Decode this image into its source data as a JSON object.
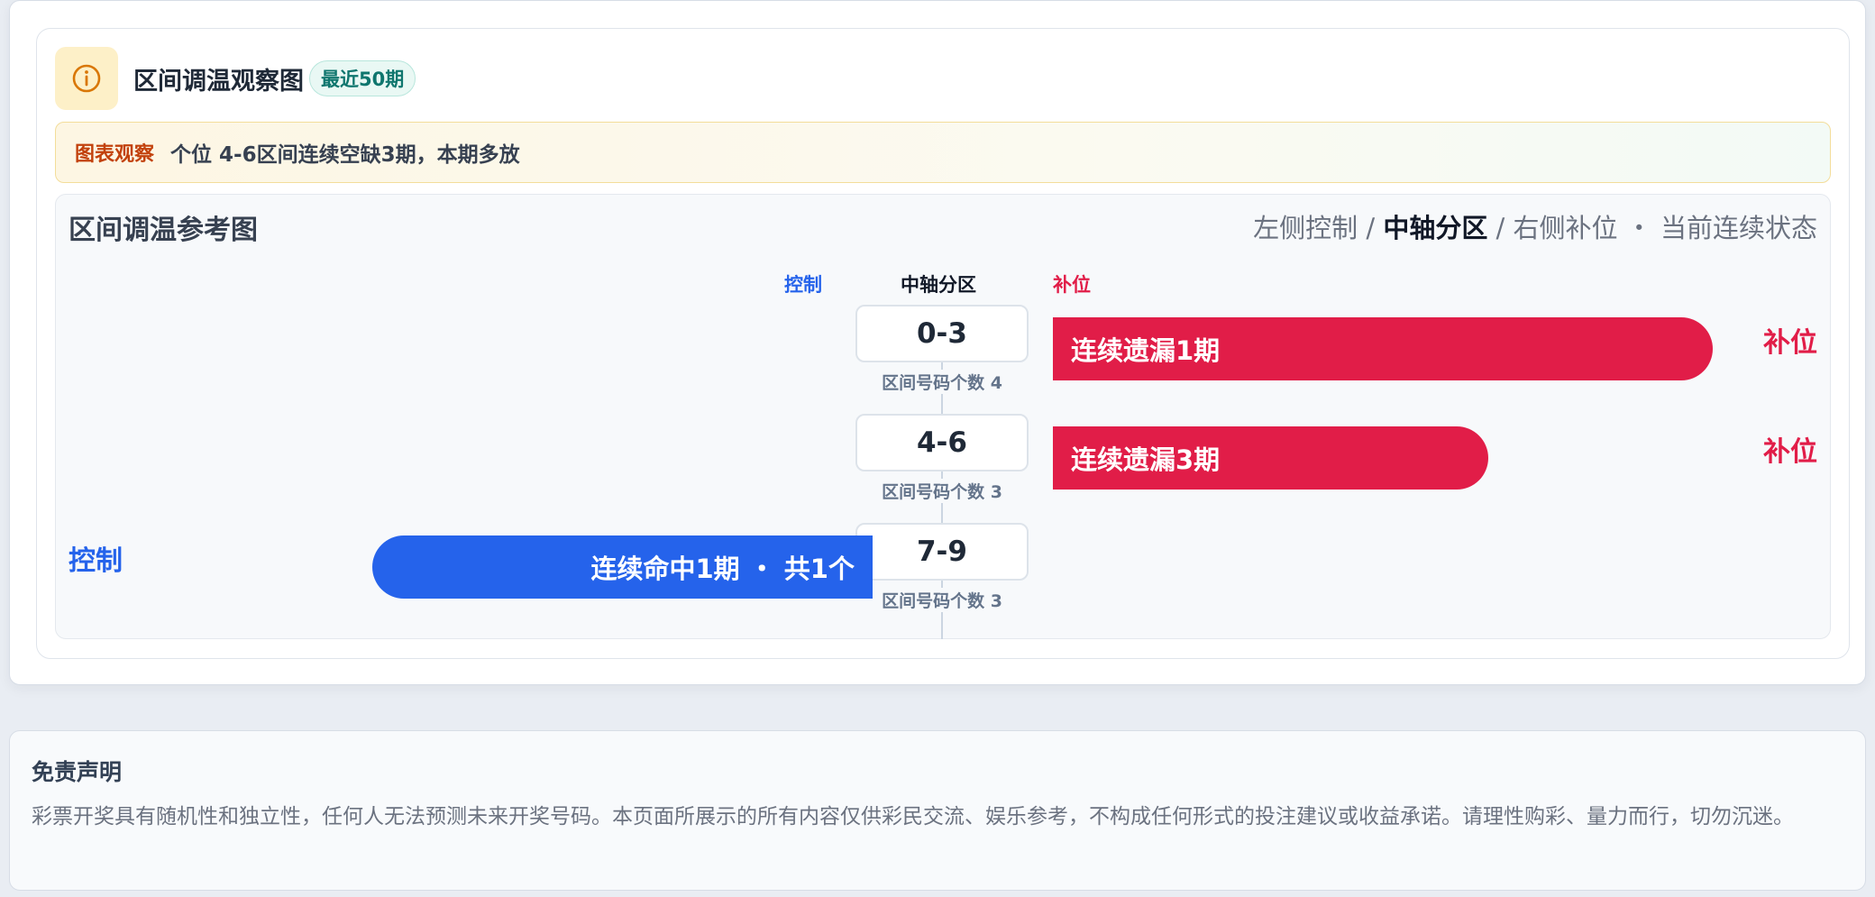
{
  "header": {
    "icon": "info-icon",
    "title": "区间调温观察图",
    "badge": "最近50期"
  },
  "observation": {
    "label": "图表观察",
    "text": "个位 4-6区间连续空缺3期，本期多放"
  },
  "panel": {
    "title": "区间调温参考图",
    "legend": {
      "left": "左侧控制 / ",
      "center": "中轴分区",
      "right": " / 右侧补位 ・ 当前连续状态"
    },
    "columns": {
      "left": "控制",
      "center": "中轴分区",
      "right": "补位"
    },
    "rows": [
      {
        "range": "0-3",
        "count_label": "区间号码个数 4",
        "side": "right",
        "bar_text": "连续遗漏1期",
        "side_label": "补位",
        "bar_fraction": 1.0
      },
      {
        "range": "4-6",
        "count_label": "区间号码个数 3",
        "side": "right",
        "bar_text": "连续遗漏3期",
        "side_label": "补位",
        "bar_fraction": 0.66
      },
      {
        "range": "7-9",
        "count_label": "区间号码个数 3",
        "side": "left",
        "bar_text": "连续命中1期 ・ 共1个",
        "side_label": "控制",
        "bar_fraction": 0.76
      }
    ]
  },
  "colors": {
    "control": "#2563eb",
    "supplement": "#e11d48",
    "badge": "#0f766e",
    "observation_label": "#c2410c"
  },
  "disclaimer": {
    "title": "免责声明",
    "text": "彩票开奖具有随机性和独立性，任何人无法预测未来开奖号码。本页面所展示的所有内容仅供彩民交流、娱乐参考，不构成任何形式的投注建议或收益承诺。请理性购彩、量力而行，切勿沉迷。"
  }
}
